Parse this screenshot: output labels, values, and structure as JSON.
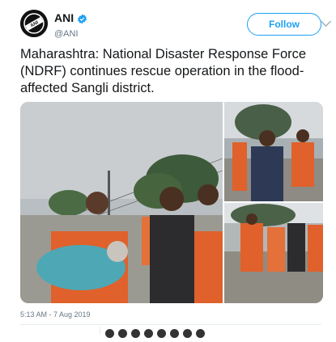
{
  "author": {
    "display_name": "ANI",
    "handle": "@ANI",
    "avatar_text": "ANI"
  },
  "follow_button": {
    "label": "Follow"
  },
  "tweet": {
    "text": "Maharashtra: National Disaster Response Force (NDRF) continues rescue operation in the flood-affected Sangli district.",
    "timestamp": "5:13 AM - 7 Aug 2019"
  },
  "media": {
    "alt_count": 3
  },
  "colors": {
    "accent": "#1da1f2",
    "muted": "#657786",
    "ndrf_orange": "#e0612b"
  }
}
